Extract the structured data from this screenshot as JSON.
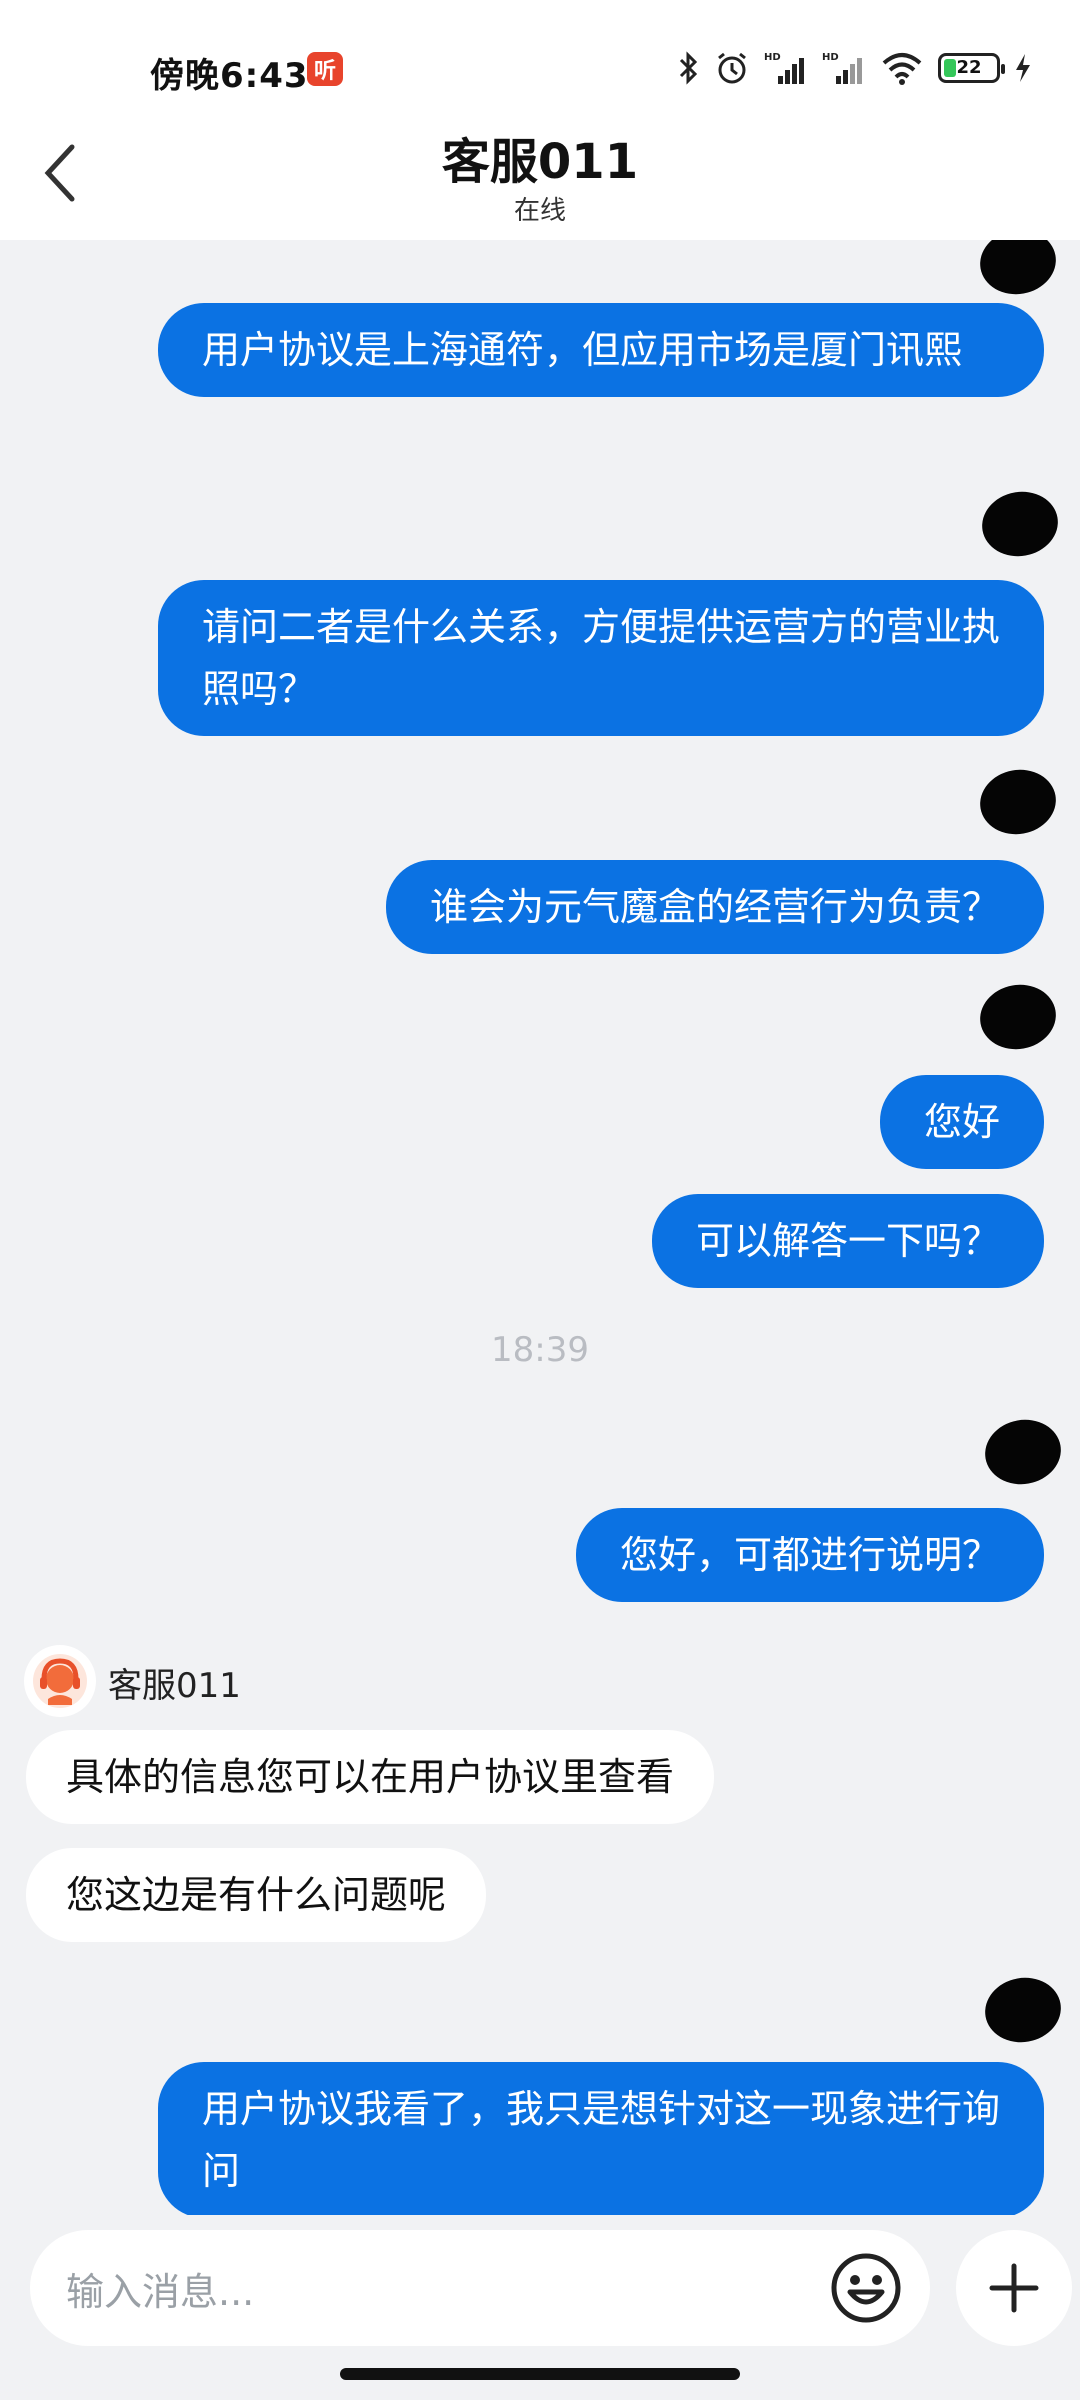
{
  "status_bar": {
    "time": "傍晚6:43",
    "listen_badge": "听",
    "battery": "22"
  },
  "header": {
    "title": "客服011",
    "status": "在线"
  },
  "messages": [
    {
      "from": "me",
      "text": "用户协议是上海通符，但应用市场是厦门讯熙"
    },
    {
      "from": "me",
      "text": "请问二者是什么关系，方便提供运营方的营业执照吗？"
    },
    {
      "from": "me",
      "text": "谁会为元气魔盒的经营行为负责？"
    },
    {
      "from": "me",
      "text": "您好"
    },
    {
      "from": "me",
      "text": "可以解答一下吗？"
    },
    {
      "from": "me",
      "text": "您好，可都进行说明？"
    },
    {
      "from": "agent",
      "text": "具体的信息您可以在用户协议里查看"
    },
    {
      "from": "agent",
      "text": "您这边是有什么问题呢"
    },
    {
      "from": "me",
      "text": "用户协议我看了，我只是想针对这一现象进行询问"
    }
  ],
  "time_divider": "18:39",
  "agent": {
    "name": "客服011"
  },
  "input": {
    "placeholder": "输入消息..."
  },
  "colors": {
    "outgoing_bubble": "#0b72e3",
    "incoming_bubble": "#ffffff",
    "background": "#f1f2f4"
  }
}
